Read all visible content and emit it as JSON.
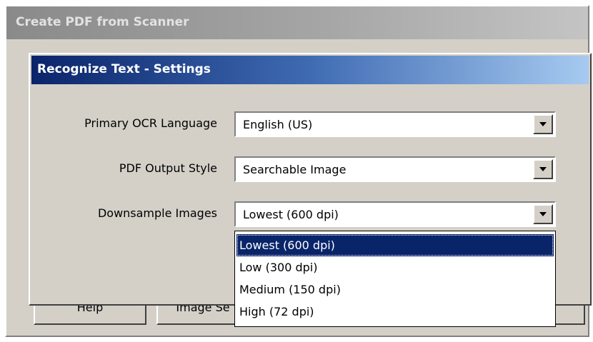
{
  "outer_window": {
    "title": "Create PDF from Scanner",
    "behind_buttons": [
      "Help",
      "Image Se"
    ]
  },
  "dialog": {
    "title": "Recognize Text - Settings",
    "fields": [
      {
        "label": "Primary OCR Language",
        "value": "English (US)"
      },
      {
        "label": "PDF Output Style",
        "value": "Searchable Image"
      },
      {
        "label": "Downsample Images",
        "value": "Lowest (600 dpi)"
      }
    ],
    "dropdown": {
      "options": [
        "Lowest (600 dpi)",
        "Low (300 dpi)",
        "Medium (150 dpi)",
        "High (72 dpi)"
      ],
      "selected_option": "Lowest (600 dpi)"
    }
  },
  "colors": {
    "dialog_title_gradient_start": "#0a246a",
    "dialog_title_gradient_end": "#a6caf0",
    "selection_highlight": "#0a246a",
    "window_face": "#d4d0c8"
  },
  "icons": {
    "combo_arrow": "chevron-down-icon"
  }
}
